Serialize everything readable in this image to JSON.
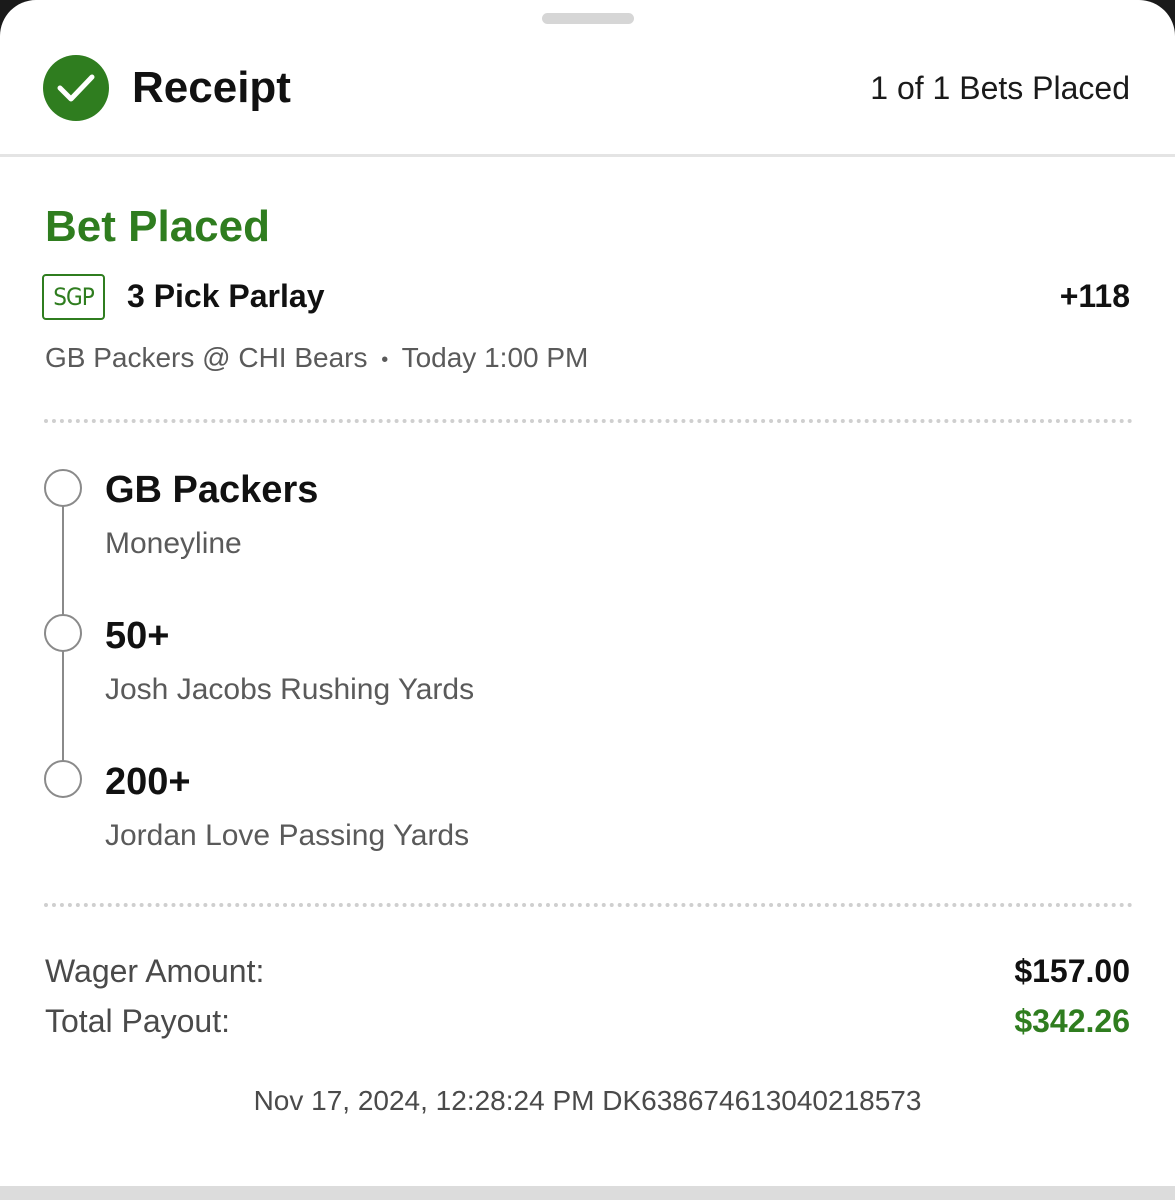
{
  "header": {
    "title": "Receipt",
    "bets_count": "1 of 1 Bets Placed",
    "icon": "check-icon"
  },
  "bet": {
    "status": "Bet Placed",
    "badge": "SGP",
    "type": "3 Pick Parlay",
    "odds": "+118",
    "game": "GB Packers @ CHI Bears",
    "separator": "•",
    "time": "Today 1:00 PM",
    "legs": [
      {
        "title": "GB Packers",
        "subtitle": "Moneyline"
      },
      {
        "title": "50+",
        "subtitle": "Josh Jacobs Rushing Yards"
      },
      {
        "title": "200+",
        "subtitle": "Jordan Love Passing Yards"
      }
    ]
  },
  "summary": {
    "wager_label": "Wager Amount:",
    "wager_value": "$157.00",
    "payout_label": "Total Payout:",
    "payout_value": "$342.26"
  },
  "footer": {
    "meta": "Nov 17, 2024, 12:28:24 PM DK638674613040218573"
  },
  "colors": {
    "accent_green": "#2f7d1f",
    "text_primary": "#111111",
    "text_secondary": "#5a5a5a"
  }
}
